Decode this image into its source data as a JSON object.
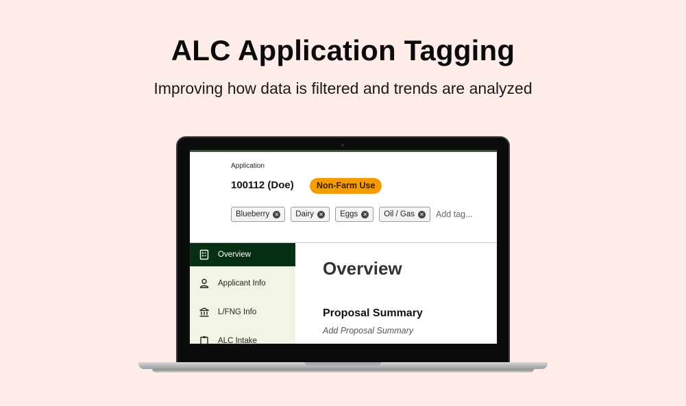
{
  "hero": {
    "title": "ALC Application Tagging",
    "subtitle": "Improving how data is filtered and trends are analyzed"
  },
  "app": {
    "eyebrow": "Application",
    "application_id": "100112 (Doe)",
    "status_badge": "Non-Farm Use",
    "tags": [
      {
        "label": "Blueberry"
      },
      {
        "label": "Dairy"
      },
      {
        "label": "Eggs"
      },
      {
        "label": "Oil / Gas"
      }
    ],
    "add_tag_placeholder": "Add tag...",
    "sidebar": {
      "items": [
        {
          "label": "Overview",
          "icon": "document-icon",
          "active": true
        },
        {
          "label": "Applicant Info",
          "icon": "person-icon",
          "active": false
        },
        {
          "label": "L/FNG Info",
          "icon": "bank-icon",
          "active": false
        },
        {
          "label": "ALC Intake",
          "icon": "clipboard-icon",
          "active": false
        }
      ]
    },
    "main": {
      "title": "Overview",
      "section_title": "Proposal Summary",
      "section_placeholder": "Add Proposal Summary"
    }
  },
  "colors": {
    "background": "#fdece8",
    "accent_green": "#062f14",
    "sidebar_bg": "#f4f4e6",
    "badge_orange": "#f59b00"
  }
}
